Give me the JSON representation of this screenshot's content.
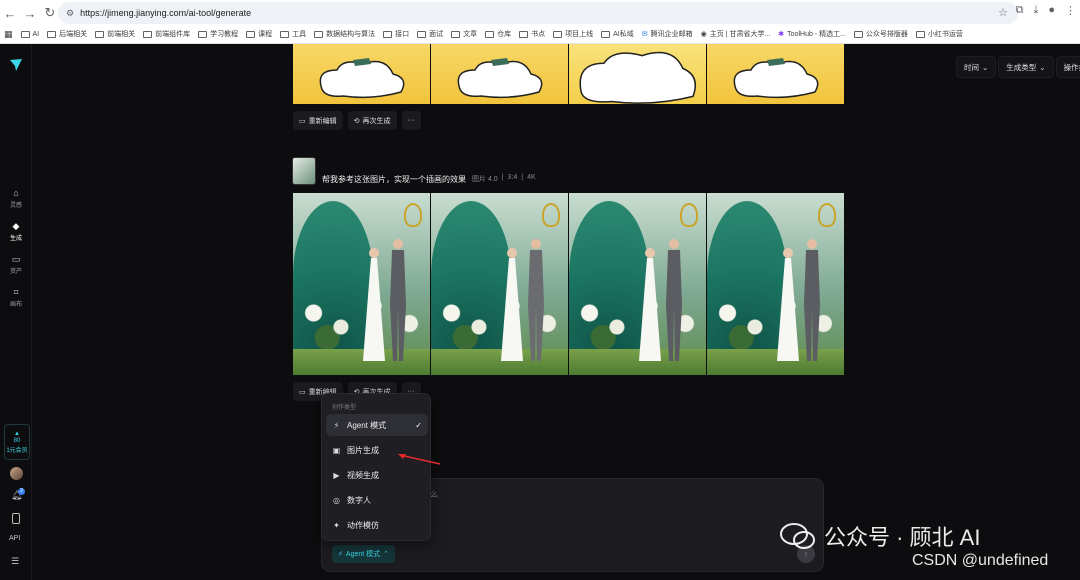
{
  "browser": {
    "url": "https://jimeng.jianying.com/ai-tool/generate",
    "bookmarks": [
      "AI",
      "后端相关",
      "前端相关",
      "前端组件库",
      "学习教程",
      "课程",
      "工具",
      "数据结构与算法",
      "接口",
      "面试",
      "文章",
      "仓库",
      "书点",
      "项目上线",
      "AI私域",
      "腾讯企业邮箱",
      "主页 | 甘肃省大学...",
      "ToolHub - 精选工...",
      "公众号排版器",
      "小红书运营"
    ]
  },
  "sidebar": {
    "items": [
      {
        "label": "灵感",
        "icon": "home-icon"
      },
      {
        "label": "生成",
        "icon": "sparkle-icon"
      },
      {
        "label": "资产",
        "icon": "folder-icon"
      },
      {
        "label": "画布",
        "icon": "canvas-icon"
      }
    ],
    "credits_value": "80",
    "credits_label": "1元会员",
    "notification_count": "2",
    "api_label": "API"
  },
  "filters": {
    "time": "时间",
    "gen_type": "生成类型",
    "op_type": "操作类型"
  },
  "actions": {
    "reedit": "重新编辑",
    "regen": "再次生成",
    "more": "···"
  },
  "prompt": {
    "text": "帮我参考这张图片，实现一个插画的效果",
    "model": "图片 4.0",
    "ratio": "3:4",
    "resolution": "4K"
  },
  "dropdown": {
    "title": "创作类型",
    "items": [
      {
        "label": "Agent 模式",
        "icon": "agent-icon",
        "checked": true
      },
      {
        "label": "图片生成",
        "icon": "image-icon"
      },
      {
        "label": "视频生成",
        "icon": "video-icon"
      },
      {
        "label": "数字人",
        "icon": "avatar-icon"
      },
      {
        "label": "动作模仿",
        "icon": "motion-icon"
      }
    ]
  },
  "input": {
    "placeholder_tail": "么",
    "mode_chip": "Agent 模式"
  },
  "watermark": {
    "line1": "公众号 · 顾北 AI",
    "line2": "CSDN @undefined"
  }
}
